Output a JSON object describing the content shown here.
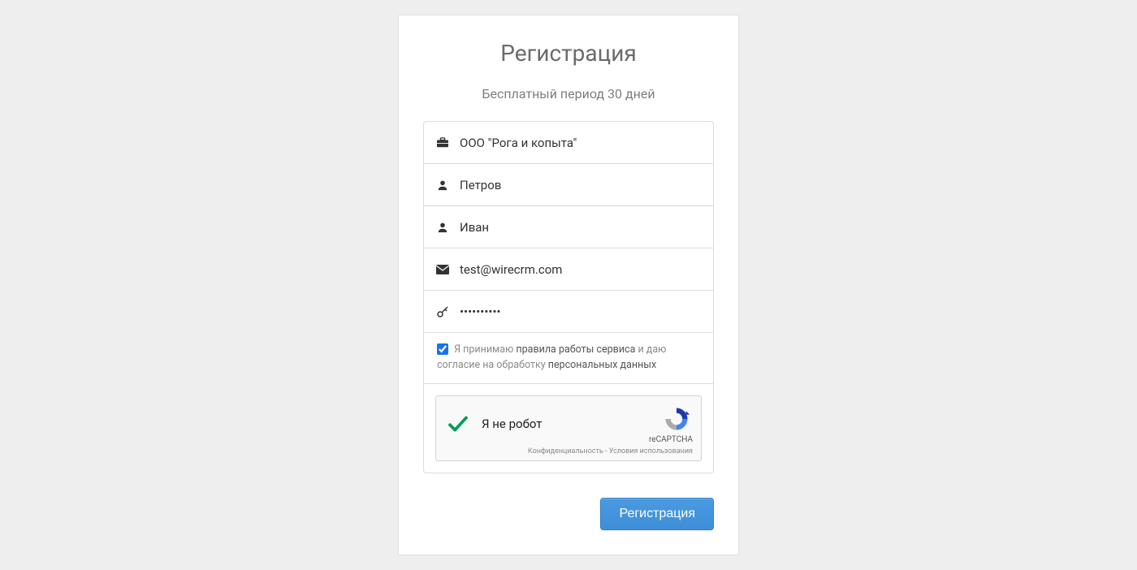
{
  "title": "Регистрация",
  "subtitle": "Бесплатный период 30 дней",
  "fields": {
    "company": "ООО \"Рога и копыта\"",
    "lastname": "Петров",
    "firstname": "Иван",
    "email": "test@wirecrm.com",
    "password": "••••••••••"
  },
  "consent": {
    "prefix": "Я принимаю ",
    "terms_link": "правила работы сервиса",
    "middle": " и даю согласие на обработку ",
    "privacy_link": "персональных данных"
  },
  "recaptcha": {
    "label": "Я не робот",
    "brand": "reCAPTCHA",
    "privacy": "Конфиденциальность",
    "separator": " - ",
    "terms": "Условия использования"
  },
  "submit_label": "Регистрация"
}
